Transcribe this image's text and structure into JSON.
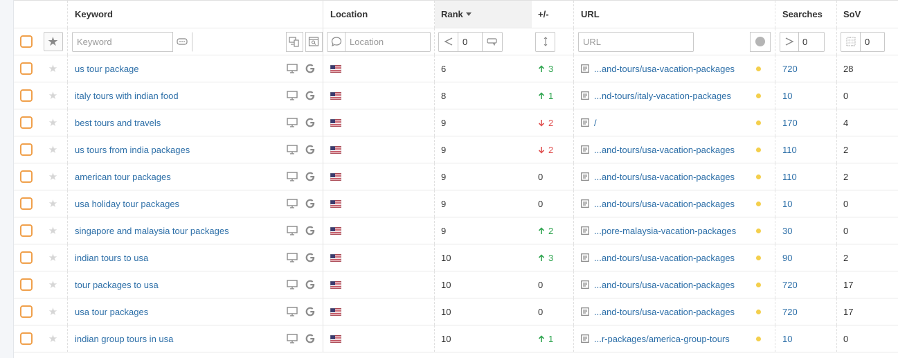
{
  "columns": {
    "keyword": "Keyword",
    "location": "Location",
    "rank": "Rank",
    "diff": "+/-",
    "url": "URL",
    "searches": "Searches",
    "sov": "SoV"
  },
  "filters": {
    "keyword_placeholder": "Keyword",
    "location_placeholder": "Location",
    "rank_value": "0",
    "url_placeholder": "URL",
    "searches_value": "0",
    "sov_value": "0"
  },
  "colors": {
    "checkbox": "#f0a04b",
    "link": "#2d6fa8",
    "up": "#2ea44f",
    "down": "#e05050",
    "url_dot": "#f4cf4c"
  },
  "icons": {
    "device": "desktop-icon",
    "engine": "google-icon",
    "location": "us-flag-icon",
    "url": "document-icon"
  },
  "rows": [
    {
      "keyword": "us tour package",
      "rank": "6",
      "change": "3",
      "dir": "up",
      "url": "...and-tours/usa-vacation-packages",
      "searches": "720",
      "sov": "28"
    },
    {
      "keyword": "italy tours with indian food",
      "rank": "8",
      "change": "1",
      "dir": "up",
      "url": "...nd-tours/italy-vacation-packages",
      "searches": "10",
      "sov": "0"
    },
    {
      "keyword": "best tours and travels",
      "rank": "9",
      "change": "2",
      "dir": "down",
      "url": "/",
      "searches": "170",
      "sov": "4"
    },
    {
      "keyword": "us tours from india packages",
      "rank": "9",
      "change": "2",
      "dir": "down",
      "url": "...and-tours/usa-vacation-packages",
      "searches": "110",
      "sov": "2"
    },
    {
      "keyword": "american tour packages",
      "rank": "9",
      "change": "0",
      "dir": "none",
      "url": "...and-tours/usa-vacation-packages",
      "searches": "110",
      "sov": "2"
    },
    {
      "keyword": "usa holiday tour packages",
      "rank": "9",
      "change": "0",
      "dir": "none",
      "url": "...and-tours/usa-vacation-packages",
      "searches": "10",
      "sov": "0"
    },
    {
      "keyword": "singapore and malaysia tour packages",
      "rank": "9",
      "change": "2",
      "dir": "up",
      "url": "...pore-malaysia-vacation-packages",
      "searches": "30",
      "sov": "0"
    },
    {
      "keyword": "indian tours to usa",
      "rank": "10",
      "change": "3",
      "dir": "up",
      "url": "...and-tours/usa-vacation-packages",
      "searches": "90",
      "sov": "2"
    },
    {
      "keyword": "tour packages to usa",
      "rank": "10",
      "change": "0",
      "dir": "none",
      "url": "...and-tours/usa-vacation-packages",
      "searches": "720",
      "sov": "17"
    },
    {
      "keyword": "usa tour packages",
      "rank": "10",
      "change": "0",
      "dir": "none",
      "url": "...and-tours/usa-vacation-packages",
      "searches": "720",
      "sov": "17"
    },
    {
      "keyword": "indian group tours in usa",
      "rank": "10",
      "change": "1",
      "dir": "up",
      "url": "...r-packages/america-group-tours",
      "searches": "10",
      "sov": "0"
    }
  ]
}
